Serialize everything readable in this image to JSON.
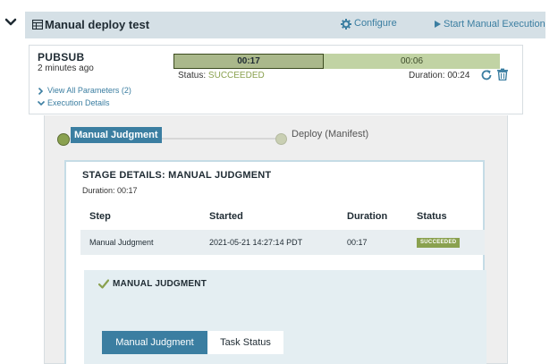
{
  "pipeline": {
    "title": "Manual deploy test",
    "configure_label": "Configure",
    "start_label": "Start Manual Execution"
  },
  "execution": {
    "trigger": "PUBSUB",
    "time_ago": "2 minutes ago",
    "progress": {
      "segment1": "00:17",
      "segment2": "00:06"
    },
    "status_label": "Status:",
    "status_value": "SUCCEEDED",
    "duration_text": "Duration: 00:24",
    "view_params_label": "View All Parameters (2)",
    "execution_details_label": "Execution Details"
  },
  "graph": {
    "stages": [
      {
        "label": "Manual Judgment"
      },
      {
        "label": "Deploy (Manifest)"
      }
    ]
  },
  "stage_details": {
    "heading": "STAGE DETAILS: MANUAL JUDGMENT",
    "duration": "Duration: 00:17",
    "columns": [
      "Step",
      "Started",
      "Duration",
      "Status"
    ],
    "rows": [
      {
        "step": "Manual Judgment",
        "started": "2021-05-21 14:27:14 PDT",
        "duration": "00:17",
        "status": "SUCCEEDED"
      }
    ]
  },
  "judgment": {
    "title": "MANUAL JUDGMENT",
    "tabs": [
      "Manual Judgment",
      "Task Status"
    ]
  },
  "colors": {
    "accent": "#3b7ea1",
    "success": "#8aa14f",
    "header_bg": "#d5e0e6"
  }
}
